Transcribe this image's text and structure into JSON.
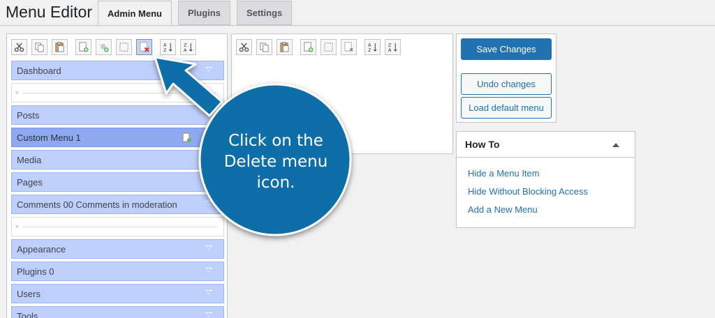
{
  "page": {
    "title": "Menu Editor"
  },
  "tabs": [
    {
      "label": "Admin Menu",
      "active": true
    },
    {
      "label": "Plugins",
      "active": false
    },
    {
      "label": "Settings",
      "active": false
    }
  ],
  "toolbar_icons": [
    "cut-icon",
    "copy-icon",
    "paste-icon",
    "new-menu-icon",
    "new-separator-icon",
    "hide-icon",
    "delete-icon",
    "sort-ascending-icon",
    "sort-descending-icon"
  ],
  "menu": {
    "items": [
      {
        "label": "Dashboard"
      },
      {
        "label": "Posts"
      },
      {
        "label": "Custom Menu 1"
      },
      {
        "label": "Media"
      },
      {
        "label": "Pages"
      },
      {
        "label": "Comments 00 Comments in moderation"
      },
      {
        "label": "Appearance"
      },
      {
        "label": "Plugins 0"
      },
      {
        "label": "Users"
      },
      {
        "label": "Tools"
      }
    ]
  },
  "actions": {
    "save": "Save Changes",
    "undo": "Undo changes",
    "load_default": "Load default menu"
  },
  "howto": {
    "title": "How To",
    "links": [
      "Hide a Menu Item",
      "Hide Without Blocking Access",
      "Add a New Menu"
    ]
  },
  "callout": {
    "text": "Click on the Delete menu icon."
  },
  "colors": {
    "accent": "#2271b1",
    "menu_item": "#bfcffc",
    "menu_active": "#8fa9f0",
    "callout": "#0a6ea8"
  }
}
